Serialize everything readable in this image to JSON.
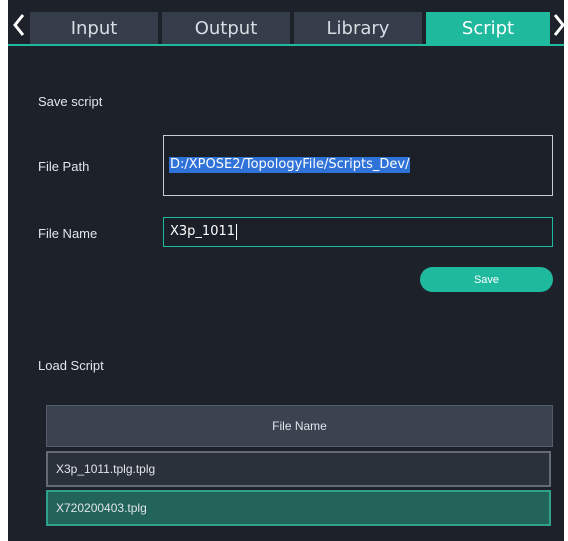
{
  "tabs": [
    {
      "label": "Input",
      "active": false
    },
    {
      "label": "Output",
      "active": false
    },
    {
      "label": "Library",
      "active": false
    },
    {
      "label": "Script",
      "active": true
    }
  ],
  "save_section": {
    "title": "Save script",
    "file_path_label": "File Path",
    "file_path_value": "D:/XPOSE2/TopologyFile/Scripts_Dev/",
    "file_name_label": "File Name",
    "file_name_value": "X3p_1011",
    "save_button": "Save"
  },
  "load_section": {
    "title": "Load Script",
    "column_header": "File Name",
    "files": [
      {
        "name": "X3p_1011.tplg.tplg",
        "selected": false
      },
      {
        "name": "X720200403.tplg",
        "selected": true
      }
    ]
  },
  "colors": {
    "accent": "#1fb99d",
    "background": "#1d222a",
    "tab_inactive": "#363d4a",
    "selection_highlight": "#2f73d8"
  },
  "icons": {
    "prev": "chevron-left-icon",
    "next": "chevron-right-icon"
  }
}
